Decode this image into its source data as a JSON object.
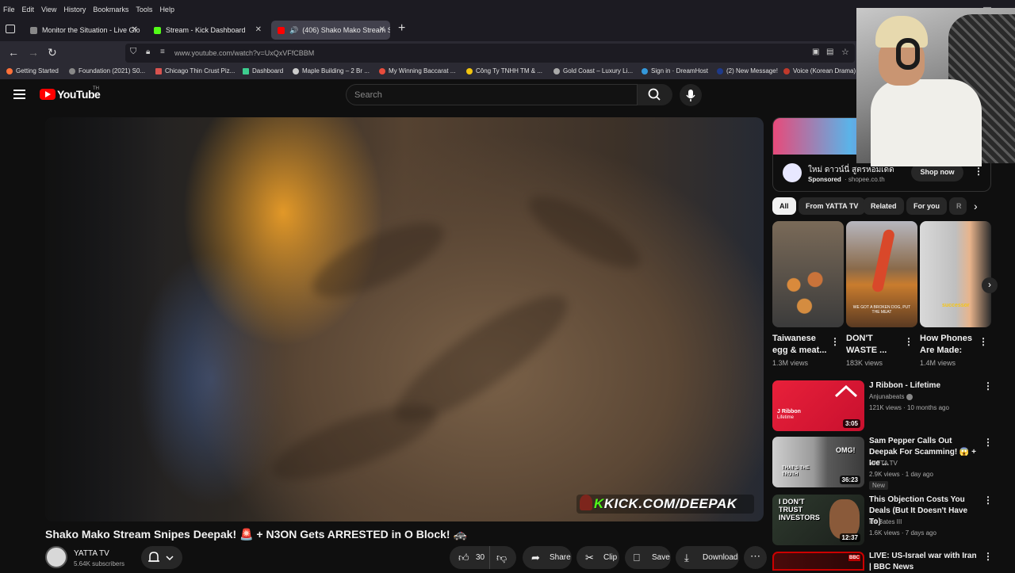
{
  "browser": {
    "menu": [
      "File",
      "Edit",
      "View",
      "History",
      "Bookmarks",
      "Tools",
      "Help"
    ],
    "tabs": [
      {
        "title": "Monitor the Situation - Live Glo",
        "color": "#888888"
      },
      {
        "title": "Stream - Kick Dashboard",
        "color": "#53fc18"
      },
      {
        "title": "(406) Shako Mako Stream S",
        "color": "#ff0000",
        "active": true
      }
    ],
    "url": "www.youtube.com/watch?v=UxQxVFfCBBM",
    "bookmarks": [
      {
        "label": "Getting Started",
        "color": "#ff7139"
      },
      {
        "label": "Foundation (2021) S0...",
        "color": "#888888"
      },
      {
        "label": "Chicago Thin Crust Piz...",
        "color": "#d9534f"
      },
      {
        "label": "Dashboard",
        "color": "#3dcd8e"
      },
      {
        "label": "Maple Building – 2 Br ...",
        "color": "#cccccc"
      },
      {
        "label": "My Winning Baccarat ...",
        "color": "#e74c3c"
      },
      {
        "label": "Công Ty TNHH TM & ...",
        "color": "#f1c40f"
      },
      {
        "label": "Gold Coast – Luxury Li...",
        "color": "#aaaaaa"
      },
      {
        "label": "Sign in · DreamHost",
        "color": "#3498db"
      },
      {
        "label": "(2) New Message!",
        "color": "#1e3a8a"
      },
      {
        "label": "Voice (Korean Drama) ...",
        "color": "#c0392b"
      }
    ]
  },
  "youtube": {
    "logo_text": "YouTube",
    "country": "TH",
    "search_placeholder": "Search"
  },
  "video": {
    "overlay_k": "K",
    "overlay_text": "KICK.COM/DEEPAK",
    "title": "Shako Mako Stream Snipes Deepak! 🚨 + N3ON Gets ARRESTED in O Block! 🚓",
    "channel": "YATTA TV",
    "subscribers": "5.64K subscribers",
    "likes": "30",
    "share": "Share",
    "clip": "Clip",
    "save": "Save",
    "download": "Download"
  },
  "ad": {
    "title": "ใหม่ ดาวน์นี่ สูตรหอมเดด",
    "sponsored": "Sponsored",
    "domain": "· shopee.co.th",
    "cta": "Shop now"
  },
  "chips": [
    "All",
    "From YATTA TV",
    "Related",
    "For you",
    "R"
  ],
  "shorts": [
    {
      "title": "Taiwanese egg & meat...",
      "views": "1.3M views"
    },
    {
      "title": "DON'T WASTE ...",
      "views": "183K views"
    },
    {
      "title": "How Phones Are Made:",
      "views": "1.4M views"
    }
  ],
  "recommended": [
    {
      "title": "J Ribbon - Lifetime",
      "channel": "Anjunabeats",
      "meta": "121K views · 10 months ago",
      "duration": "3:05",
      "badge": ""
    },
    {
      "title": "Sam Pepper Calls Out Deepak For Scamming! 😱 + Ice ...",
      "channel": "YATTA TV",
      "meta": "2.9K views · 1 day ago",
      "duration": "36:23",
      "badge": "New"
    },
    {
      "title": "This Objection Costs You Deals (But It Doesn't Have To)",
      "channel": "RJ Bates III",
      "meta": "1.6K views · 7 days ago",
      "duration": "12:37",
      "badge": ""
    },
    {
      "title": "LIVE: US-Israel war with Iran | BBC News",
      "channel": "",
      "meta": "",
      "duration": "",
      "badge": ""
    }
  ],
  "thumb_text": {
    "ribbon_title": "J Ribbon",
    "ribbon_sub": "Lifetime",
    "omg": "OMG!",
    "truth": "THAT'S THE TRUTH",
    "investors": "I DON'T TRUST INVESTORS",
    "short3": "successor",
    "short2": "WE GOT A BROKEN DOG, PUT THE MEAT"
  }
}
